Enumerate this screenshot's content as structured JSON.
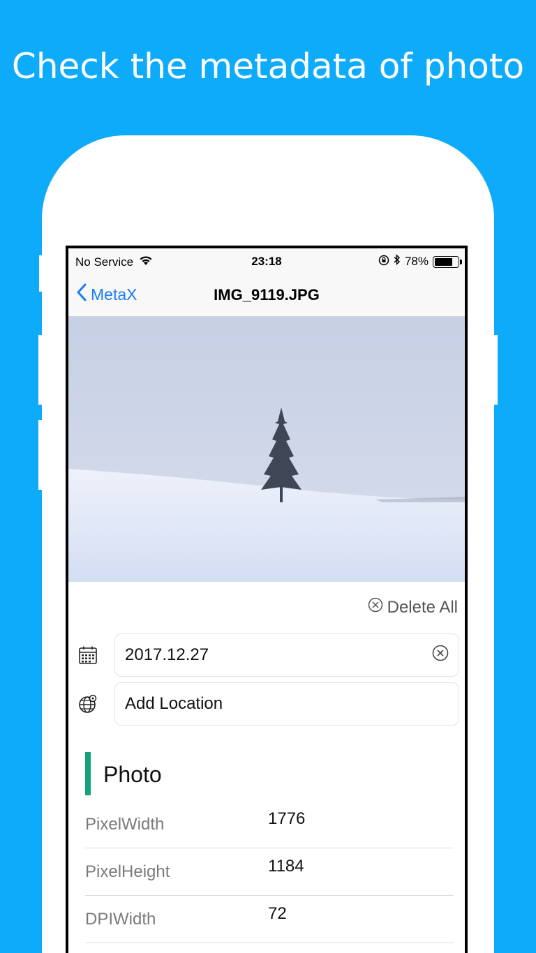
{
  "headline": "Check the metadata of photo",
  "status_bar": {
    "carrier": "No Service",
    "time": "23:18",
    "battery_percent": "78%",
    "battery_level": 0.78
  },
  "nav": {
    "back_label": "MetaX",
    "title": "IMG_9119.JPG"
  },
  "actions": {
    "delete_all_label": "Delete All"
  },
  "fields": {
    "date_value": "2017.12.27",
    "location_label": "Add Location"
  },
  "section": {
    "title": "Photo",
    "rows": [
      {
        "key": "PixelWidth",
        "value": "1776"
      },
      {
        "key": "PixelHeight",
        "value": "1184"
      },
      {
        "key": "DPIWidth",
        "value": "72"
      }
    ]
  },
  "colors": {
    "background": "#0dabf9",
    "accent_link": "#1a7cf5",
    "section_bar": "#13a27a"
  },
  "icons": [
    "wifi-icon",
    "orientation-lock-icon",
    "bluetooth-icon",
    "battery-icon",
    "chevron-left-icon",
    "clear-circle-icon",
    "calendar-icon",
    "globe-location-icon"
  ]
}
